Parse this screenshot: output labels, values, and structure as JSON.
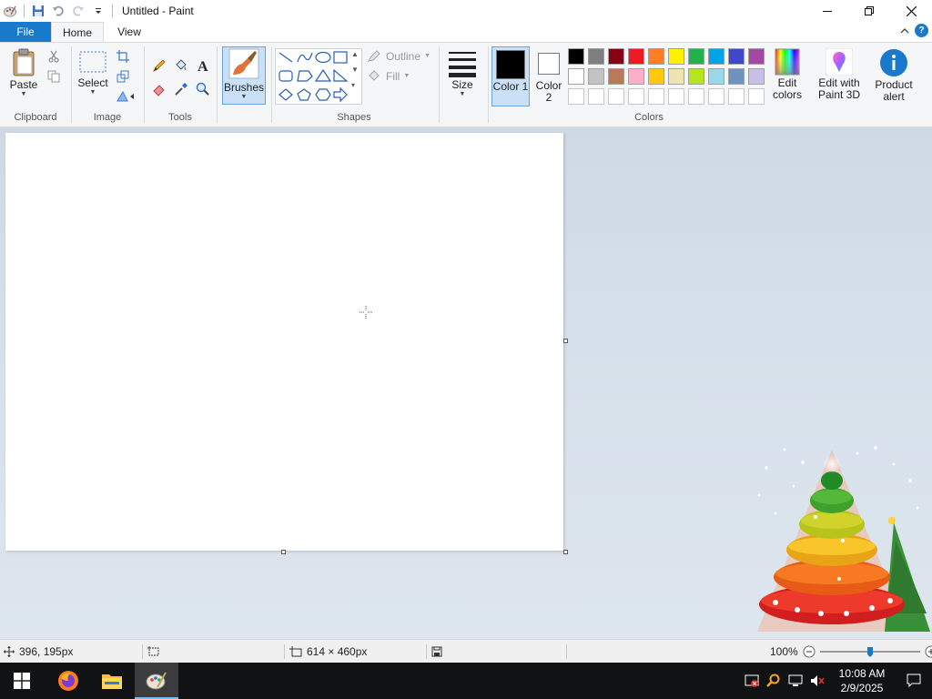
{
  "window": {
    "title": "Untitled - Paint"
  },
  "tabs": {
    "file": "File",
    "home": "Home",
    "view": "View"
  },
  "ribbon": {
    "clipboard": {
      "label": "Clipboard",
      "paste": "Paste"
    },
    "image": {
      "label": "Image",
      "select": "Select"
    },
    "tools": {
      "label": "Tools"
    },
    "brushes": {
      "label": "Brushes"
    },
    "shapes": {
      "label": "Shapes",
      "outline": "Outline",
      "fill": "Fill"
    },
    "size": {
      "label": "Size"
    },
    "colors": {
      "label": "Colors",
      "color1": "Color 1",
      "color2": "Color 2",
      "color1_value": "#000000",
      "color2_value": "#ffffff",
      "palette_row1": [
        "#000000",
        "#7f7f7f",
        "#880015",
        "#ed1c24",
        "#ff7f27",
        "#fff200",
        "#22b14c",
        "#00a2e8",
        "#3f48cc",
        "#a349a4"
      ],
      "palette_row2": [
        "#ffffff",
        "#c3c3c3",
        "#b97a57",
        "#ffaec9",
        "#ffc90e",
        "#efe4b0",
        "#b5e61d",
        "#99d9ea",
        "#7092be",
        "#c8bfe7"
      ],
      "edit_colors": "Edit colors",
      "edit_paint3d": "Edit with Paint 3D",
      "product_alert": "Product alert"
    }
  },
  "status": {
    "cursor_pos": "396, 195px",
    "canvas_size": "614 × 460px",
    "zoom": "100%"
  },
  "taskbar": {
    "time": "10:08 AM",
    "date": "2/9/2025"
  }
}
